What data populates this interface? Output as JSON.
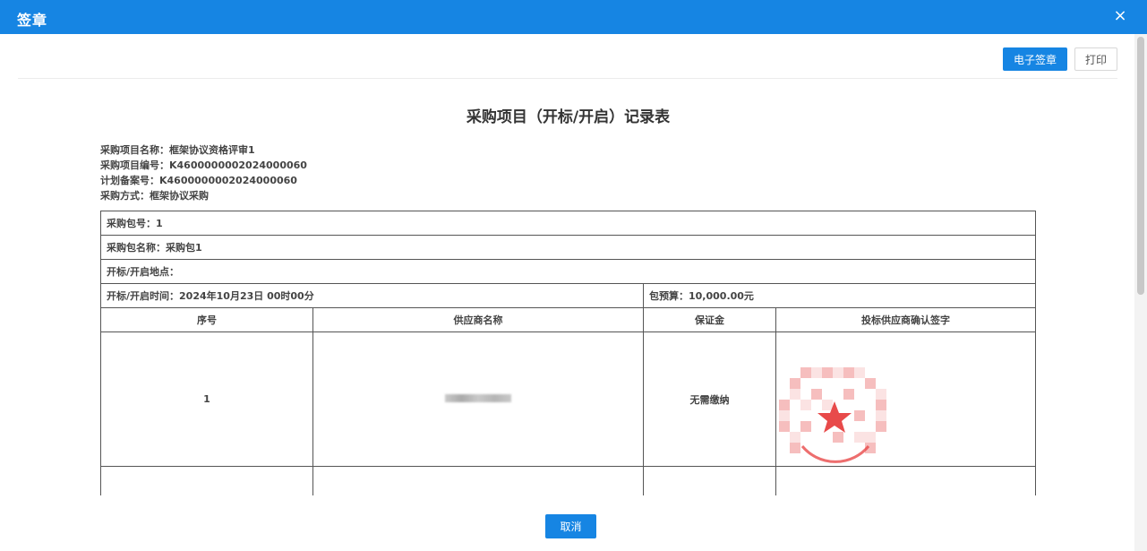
{
  "dialog": {
    "title": "签章",
    "close_symbol": "×"
  },
  "toolbar": {
    "esign_label": "电子签章",
    "print_label": "打印"
  },
  "document": {
    "title": "采购项目（开标/开启）记录表",
    "info_lines": [
      "采购项目名称：框架协议资格评审1",
      "采购项目编号：K4600000002024000060",
      "计划备案号：K4600000002024000060",
      "采购方式：框架协议采购"
    ]
  },
  "table": {
    "package_no": "采购包号：1",
    "package_name": "采购包名称：采购包1",
    "location": "开标/开启地点：",
    "open_time": "开标/开启时间：2024年10月23日 00时00分",
    "budget": "包预算：10,000.00元",
    "headers": [
      "序号",
      "供应商名称",
      "保证金",
      "投标供应商确认签字"
    ],
    "rows": [
      {
        "index": "1",
        "supplier_redacted": true,
        "deposit": "无需缴纳",
        "signature_icon": "red-seal-stamp"
      }
    ]
  },
  "footer": {
    "cancel_label": "取消"
  },
  "colors": {
    "primary": "#1685e3",
    "seal": "#e84a4a"
  }
}
